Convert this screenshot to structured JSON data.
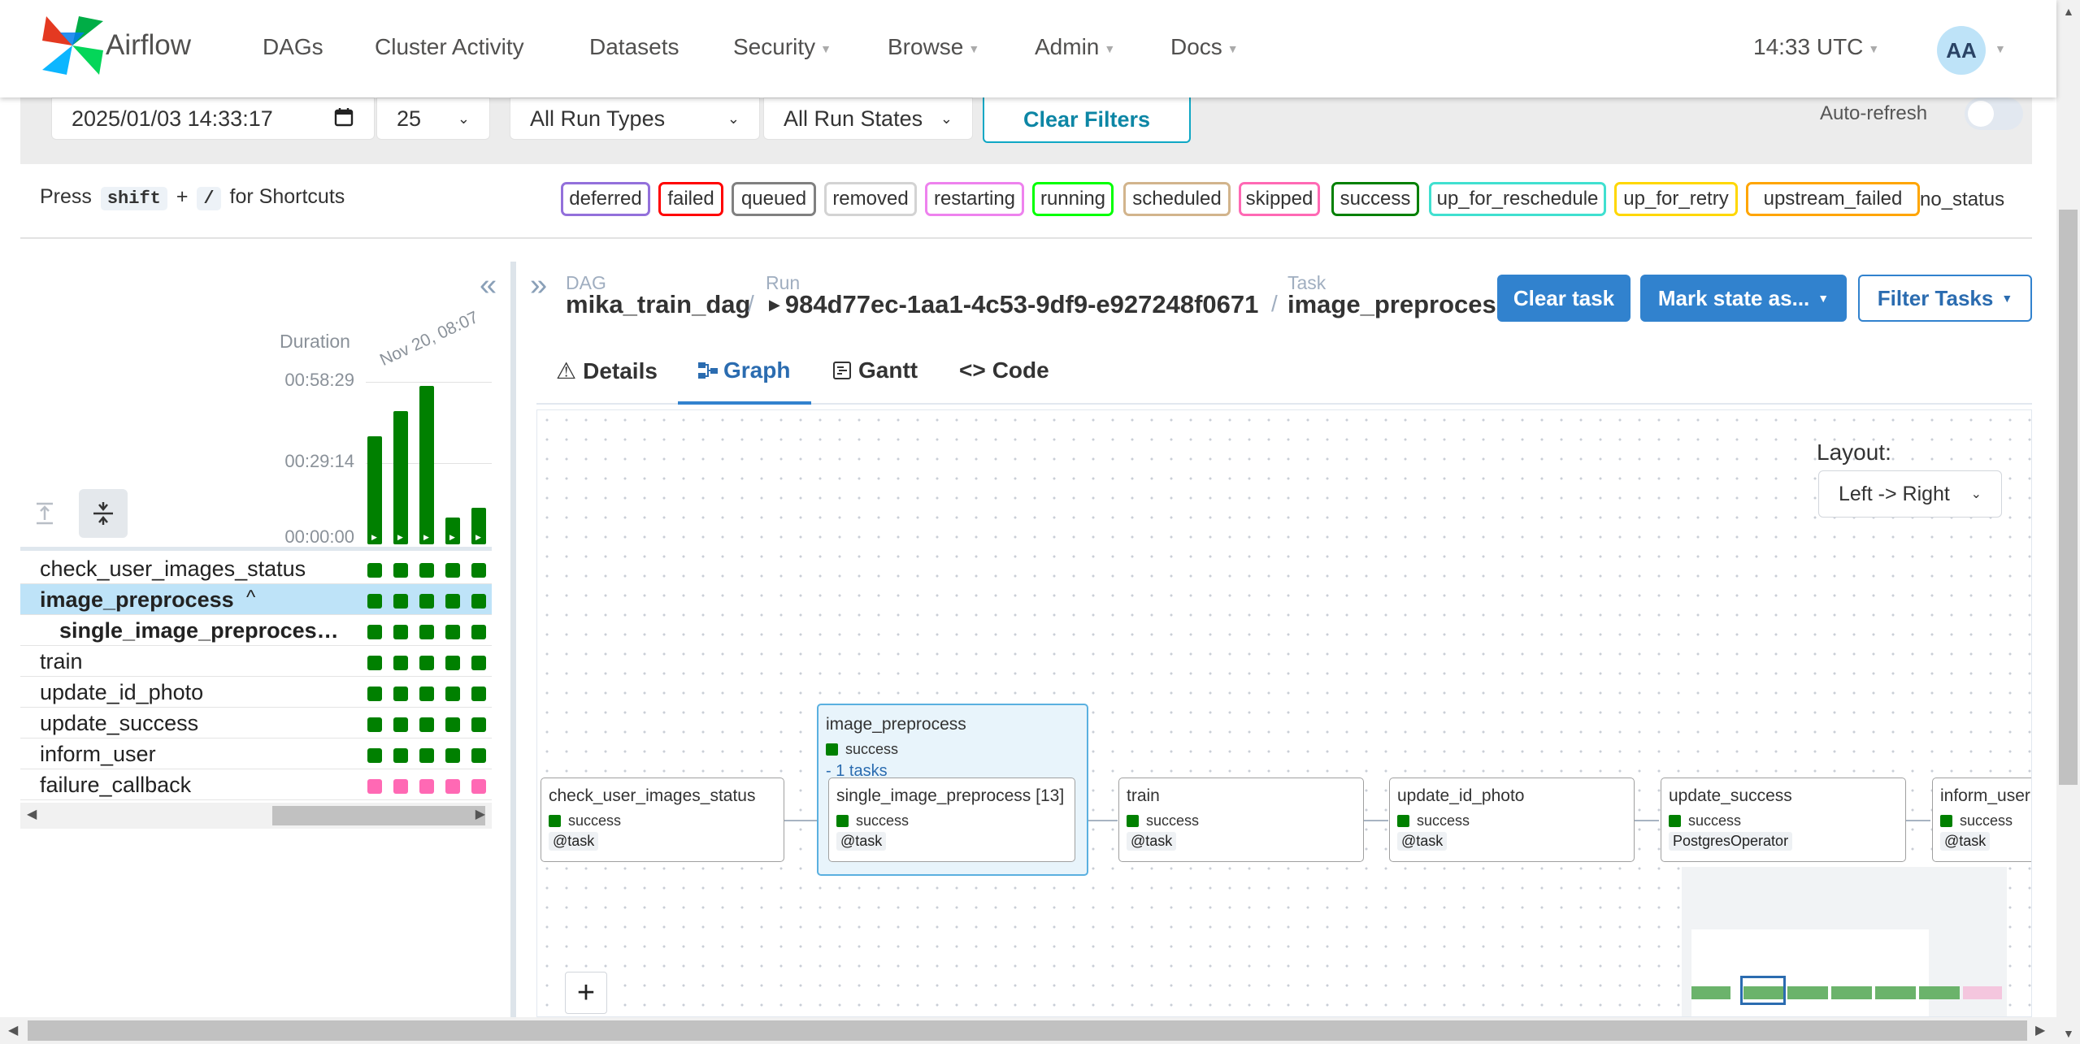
{
  "nav": {
    "brand": "Airflow",
    "items": [
      "DAGs",
      "Cluster Activity",
      "Datasets",
      "Security",
      "Browse",
      "Admin",
      "Docs"
    ],
    "clock": "14:33 UTC",
    "avatar": "AA"
  },
  "filters": {
    "date": "2025/01/03 14:33:17",
    "num_runs": "25",
    "run_types": "All Run Types",
    "run_states": "All Run States",
    "clear": "Clear Filters",
    "auto_refresh": "Auto-refresh",
    "auto_refresh_on": false
  },
  "shortcuts": {
    "press": "Press",
    "key1": "shift",
    "plus": "+",
    "key2": "/",
    "suffix": "for Shortcuts"
  },
  "states": [
    {
      "label": "deferred",
      "color": "#9370db"
    },
    {
      "label": "failed",
      "color": "#ff0000"
    },
    {
      "label": "queued",
      "color": "#808080"
    },
    {
      "label": "removed",
      "color": "#d3d3d3"
    },
    {
      "label": "restarting",
      "color": "#ee82ee"
    },
    {
      "label": "running",
      "color": "#00ff00"
    },
    {
      "label": "scheduled",
      "color": "#d2b48c"
    },
    {
      "label": "skipped",
      "color": "#ff69b4"
    },
    {
      "label": "success",
      "color": "#008000"
    },
    {
      "label": "up_for_reschedule",
      "color": "#40e0d0"
    },
    {
      "label": "up_for_retry",
      "color": "#ffd700"
    },
    {
      "label": "upstream_failed",
      "color": "#ffa500"
    }
  ],
  "no_status": "no_status",
  "grid": {
    "duration_label": "Duration",
    "run_date_label": "Nov 20, 08:07",
    "ticks": [
      "00:58:29",
      "00:29:14",
      "00:00:00"
    ],
    "run_durations_fraction": [
      0.68,
      0.84,
      1.0,
      0.17,
      0.23
    ],
    "tasks": [
      {
        "name": "check_user_images_status",
        "state_color": "#008000"
      },
      {
        "name": "image_preprocess",
        "state_color": "#008000",
        "group": true
      },
      {
        "name": "single_image_preproces…",
        "state_color": "#008000"
      },
      {
        "name": "train",
        "state_color": "#008000"
      },
      {
        "name": "update_id_photo",
        "state_color": "#008000"
      },
      {
        "name": "update_success",
        "state_color": "#008000"
      },
      {
        "name": "inform_user",
        "state_color": "#008000"
      },
      {
        "name": "failure_callback",
        "state_color": "#ff69b4"
      }
    ]
  },
  "breadcrumb": {
    "dag_label": "DAG",
    "dag": "mika_train_dag",
    "run_label": "Run",
    "run": "984d77ec-1aa1-4c53-9df9-e927248f0671",
    "task_label": "Task",
    "task": "image_preprocess"
  },
  "actions": {
    "clear_task": "Clear task",
    "mark_state": "Mark state as...",
    "filter_tasks": "Filter Tasks"
  },
  "tabs": [
    "Details",
    "Graph",
    "Gantt",
    "Code"
  ],
  "graph": {
    "layout_label": "Layout:",
    "layout_value": "Left -> Right",
    "group": {
      "title": "image_preprocess",
      "state": "success",
      "count": "- 1 tasks"
    },
    "nodes": [
      {
        "title": "check_user_images_status",
        "state": "success",
        "op": "@task"
      },
      {
        "title": "single_image_preprocess [13]",
        "state": "success",
        "op": "@task"
      },
      {
        "title": "train",
        "state": "success",
        "op": "@task"
      },
      {
        "title": "update_id_photo",
        "state": "success",
        "op": "@task"
      },
      {
        "title": "update_success",
        "state": "success",
        "op": "PostgresOperator"
      },
      {
        "title": "inform_user",
        "state": "success",
        "op": "@task"
      }
    ],
    "zoom_in": "+"
  }
}
